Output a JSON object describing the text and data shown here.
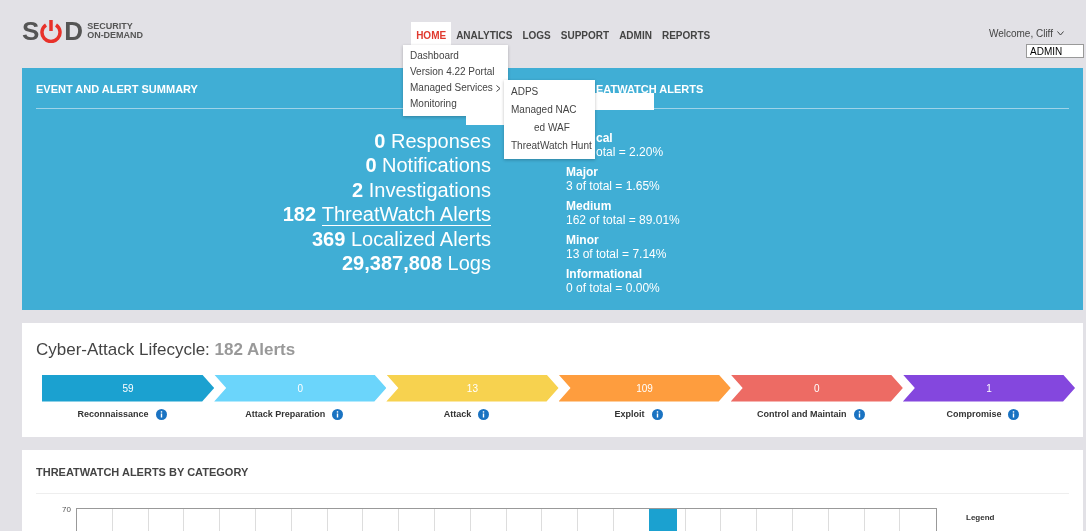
{
  "header": {
    "logo": {
      "mark": "S",
      "mark_end": "D",
      "line1": "SECURITY",
      "line2": "ON-DEMAND"
    },
    "nav": [
      {
        "label": "HOME",
        "selected": true
      },
      {
        "label": "ANALYTICS",
        "selected": false
      },
      {
        "label": "LOGS",
        "selected": false
      },
      {
        "label": "SUPPORT",
        "selected": false
      },
      {
        "label": "ADMIN",
        "selected": false
      },
      {
        "label": "REPORTS",
        "selected": false
      }
    ],
    "welcome": "Welcome, Cliff",
    "role_field": "ADMIN"
  },
  "home_menu": {
    "items": [
      {
        "label": "Dashboard",
        "submenu": false
      },
      {
        "label": "Version 4.22 Portal",
        "submenu": false
      },
      {
        "label": "Managed Services",
        "submenu": true
      },
      {
        "label": "Monitoring",
        "submenu": false
      }
    ],
    "submenu": [
      "ADPS",
      "Managed NAC",
      "ed WAF",
      "ThreatWatch Hunt"
    ]
  },
  "summary": {
    "title": "EVENT AND ALERT SUMMARY",
    "stats": [
      {
        "text": "**0** Responses",
        "link": false
      },
      {
        "text": "**0** Notifications",
        "link": false
      },
      {
        "text": "**2** Investigations",
        "link": false
      },
      {
        "text": "**182** ThreatWatch Alerts",
        "link": true
      },
      {
        "text": "**369** Localized Alerts",
        "link": false
      },
      {
        "text": "**29,387,808** Logs",
        "link": false
      }
    ]
  },
  "threatwatch": {
    "title": "EATWATCH ALERTS",
    "levels": [
      {
        "name": "cal",
        "detail": "otal = 2.20%"
      },
      {
        "name": "Major",
        "detail": "3 of total = 1.65%"
      },
      {
        "name": "Medium",
        "detail": "162 of total = 89.01%"
      },
      {
        "name": "Minor",
        "detail": "13 of total = 7.14%"
      },
      {
        "name": "Informational",
        "detail": "0 of total = 0.00%"
      }
    ]
  },
  "lifecycle": {
    "title": "Cyber-Attack Lifecycle:",
    "count": "182 Alerts",
    "stages": [
      {
        "value": "59",
        "label": "Reconnaissance",
        "color": "#1ba1d0"
      },
      {
        "value": "0",
        "label": "Attack Preparation",
        "color": "#6bd5fb"
      },
      {
        "value": "13",
        "label": "Attack",
        "color": "#f7d24f"
      },
      {
        "value": "109",
        "label": "Exploit",
        "color": "#fe9d3e"
      },
      {
        "value": "0",
        "label": "Control and Maintain",
        "color": "#ed6b64"
      },
      {
        "value": "1",
        "label": "Compromise",
        "color": "#8447de"
      }
    ]
  },
  "category": {
    "title": "THREATWATCH ALERTS BY CATEGORY",
    "y_tick_label": "70",
    "legend": "Legend"
  }
}
